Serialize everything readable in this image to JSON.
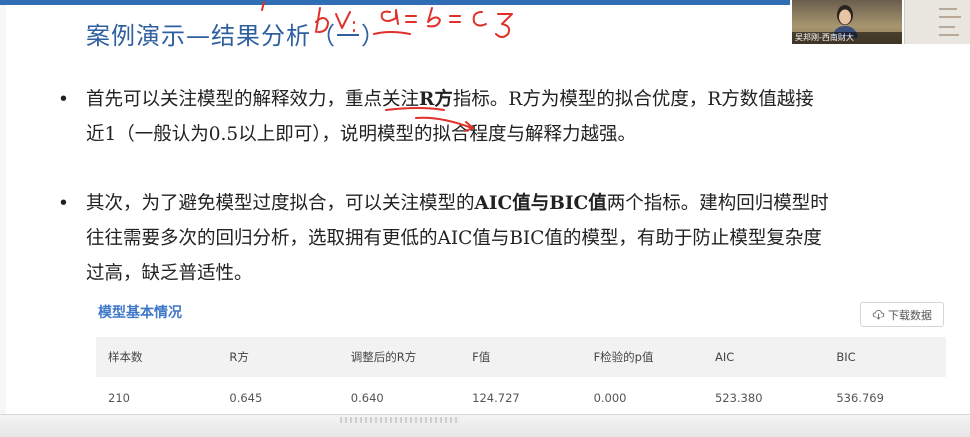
{
  "slide": {
    "title": "案例演示—结果分析（一）",
    "bullet_symbol": "•",
    "bullet1": {
      "line1_a": "首先可以关注模型的解释效力，重点关注",
      "line1_b": "R方",
      "line1_c": "指标。R方为模型的拟合优度，R方数值越接",
      "line2": "近1（一般认为0.5以上即可），说明模型的拟合程度与解释力越强。"
    },
    "bullet2": {
      "line1_a": "其次，为了避免模型过度拟合，可以关注模型的",
      "line1_b": "AIC值与BIC值",
      "line1_c": "两个指标。建构回归模型时",
      "line2": "往往需要多次的回归分析，选取拥有更低的AIC值与BIC值的模型，有助于防止模型复杂度",
      "line3": "过高，缺乏普适性。"
    }
  },
  "panel": {
    "title": "模型基本情况",
    "download_label": "下载数据",
    "columns": [
      "样本数",
      "R方",
      "调整后的R方",
      "F值",
      "F检验的p值",
      "AIC",
      "BIC"
    ],
    "rows": [
      [
        "210",
        "0.645",
        "0.640",
        "124.727",
        "0.000",
        "523.380",
        "536.769"
      ]
    ]
  },
  "webcam": {
    "caption": "吴邦刚-西南财大"
  },
  "colors": {
    "title": "#2e5f9e",
    "accent_blue": "#3f78c7",
    "annotation_red": "#e0302a"
  }
}
